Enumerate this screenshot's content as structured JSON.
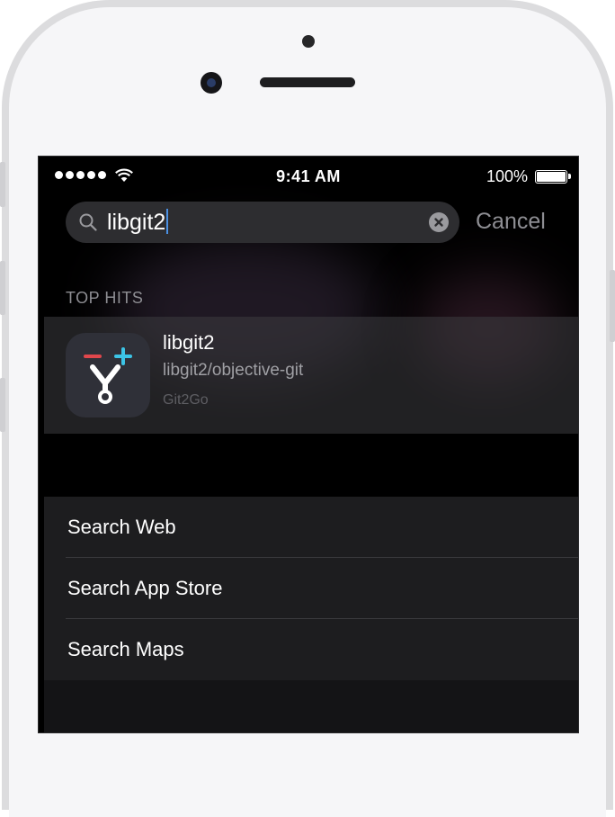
{
  "status_bar": {
    "time": "9:41 AM",
    "battery": "100%"
  },
  "search": {
    "query": "libgit2",
    "cancel_label": "Cancel"
  },
  "sections": {
    "top_hits_header": "TOP HITS"
  },
  "top_hit": {
    "title": "libgit2",
    "subtitle": "libgit2/objective-git",
    "app_name": "Git2Go",
    "icon": "git2go-app-icon"
  },
  "actions": [
    {
      "label": "Search Web"
    },
    {
      "label": "Search App Store"
    },
    {
      "label": "Search Maps"
    }
  ],
  "colors": {
    "accent_caret": "#4a90e2",
    "icon_minus": "#e0474c",
    "icon_plus": "#3cc4e6"
  }
}
